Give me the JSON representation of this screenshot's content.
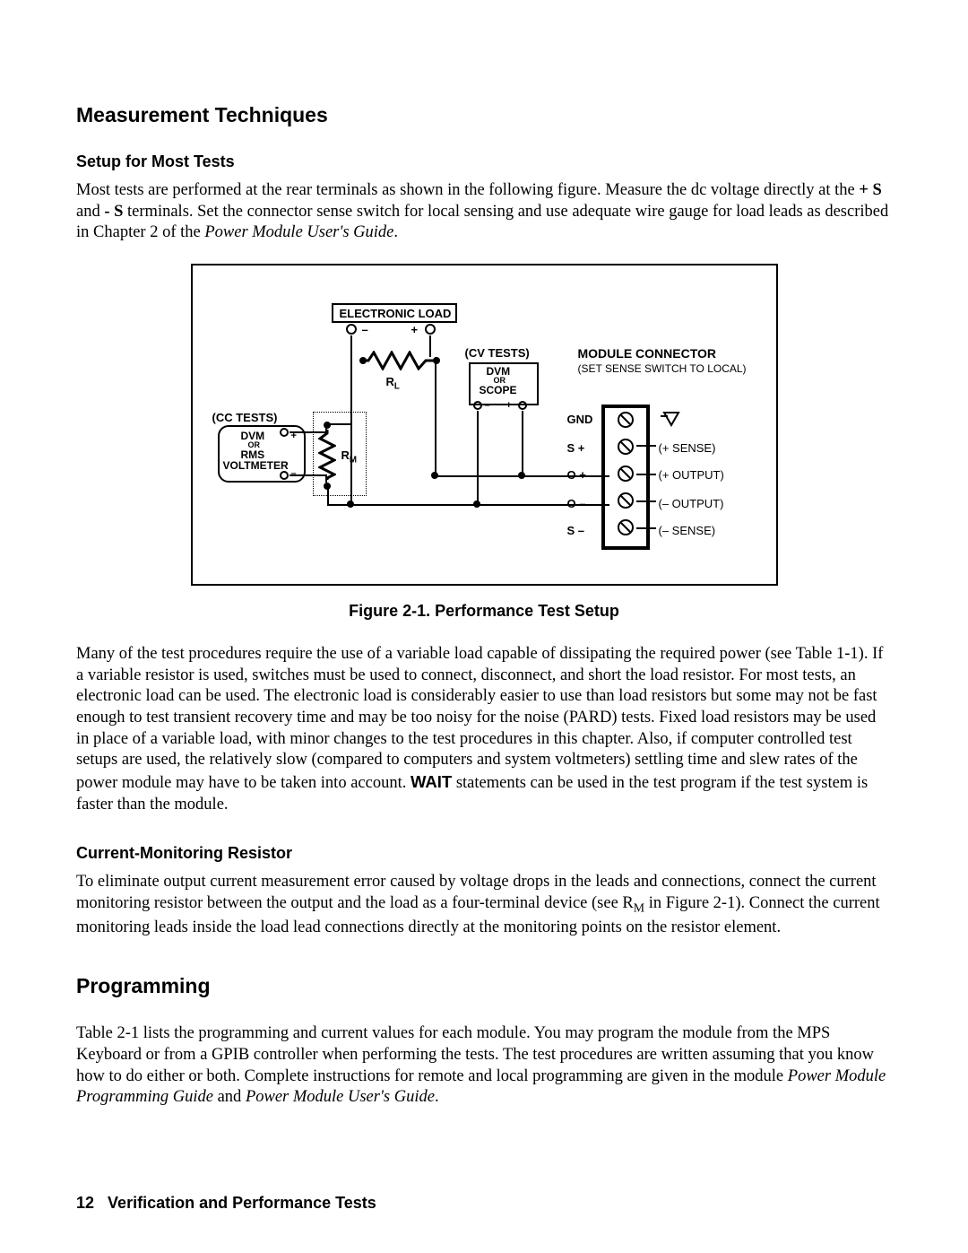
{
  "headings": {
    "measurement": "Measurement Techniques",
    "setup": "Setup for Most Tests",
    "cmr": "Current-Monitoring Resistor",
    "programming": "Programming"
  },
  "paragraphs": {
    "setup_lead": "Most tests are performed at the rear terminals as shown in the following figure. Measure the dc voltage directly at the ",
    "setup_plusS": "+ S",
    "setup_mid1": " and ",
    "setup_minusS": "- S",
    "setup_mid2": " terminals. Set the connector sense switch for local sensing and use adequate wire gauge for load leads as described in Chapter 2 of the ",
    "setup_guide": "Power Module User's Guide",
    "setup_end": ".",
    "many_lead": "Many of the test procedures require the use of a variable load capable of dissipating the required power (see Table 1-1). If a variable resistor is used, switches must be used to connect, disconnect, and short the load resistor. For most tests, an electronic load can be used. The electronic load is considerably easier to use than load resistors but some may not be fast enough to test transient recovery time and may be too noisy for the noise (PARD) tests. Fixed load resistors may be used in place of a variable load, with minor changes to the test procedures in this chapter. Also, if computer controlled test setups are used, the relatively slow (compared to computers and system voltmeters) settling time and slew rates of the power module may have to be taken into account. ",
    "many_wait": "WAIT",
    "many_tail": " statements can be used in the test program if the test system is faster than the module.",
    "cmr_lead": "To eliminate output current measurement error caused by voltage drops in the leads and connections, connect the current monitoring resistor between the output and the load as a four-terminal device (see R",
    "cmr_sub": "M",
    "cmr_tail": " in Figure 2-1). Connect the current monitoring leads inside the load lead connections directly at the monitoring points on the resistor element.",
    "prog_lead": "Table 2-1 lists the programming and current values for each module. You may program the module from the MPS Keyboard or from a GPIB controller when performing the tests. The test procedures are written assuming that you know how to do either or both. Complete instructions for remote and local programming are given in the module ",
    "prog_guide1": "Power Module Programming Guide",
    "prog_and": " and ",
    "prog_guide2": "Power Module User's Guide",
    "prog_end": "."
  },
  "figure": {
    "caption": "Figure 2-1.  Performance Test Setup",
    "labels": {
      "eload": "ELECTRONIC LOAD",
      "cvtests": "(CV  TESTS)",
      "cctests": "(CC  TESTS)",
      "dvm_or": "DVM",
      "or": "OR",
      "scope": "SCOPE",
      "rms": "RMS",
      "voltmeter": "VOLTMETER",
      "rl": "R",
      "rl_sub": "L",
      "rm": "R",
      "rm_sub": "M",
      "modconn": "MODULE  CONNECTOR",
      "setsense": "(SET SENSE SWITCH TO LOCAL)",
      "gnd": "GND",
      "s_plus": "S  +",
      "o_plus": "O  +",
      "o_minus": "O  –",
      "s_minus": "S  –",
      "plus_sense": "(+  SENSE)",
      "plus_output": "(+  OUTPUT)",
      "minus_output": "(–  OUTPUT)",
      "minus_sense": "(–  SENSE)",
      "plus": "+",
      "minus": "–"
    }
  },
  "footer": {
    "page_num": "12",
    "title": "Verification and Performance Tests"
  }
}
